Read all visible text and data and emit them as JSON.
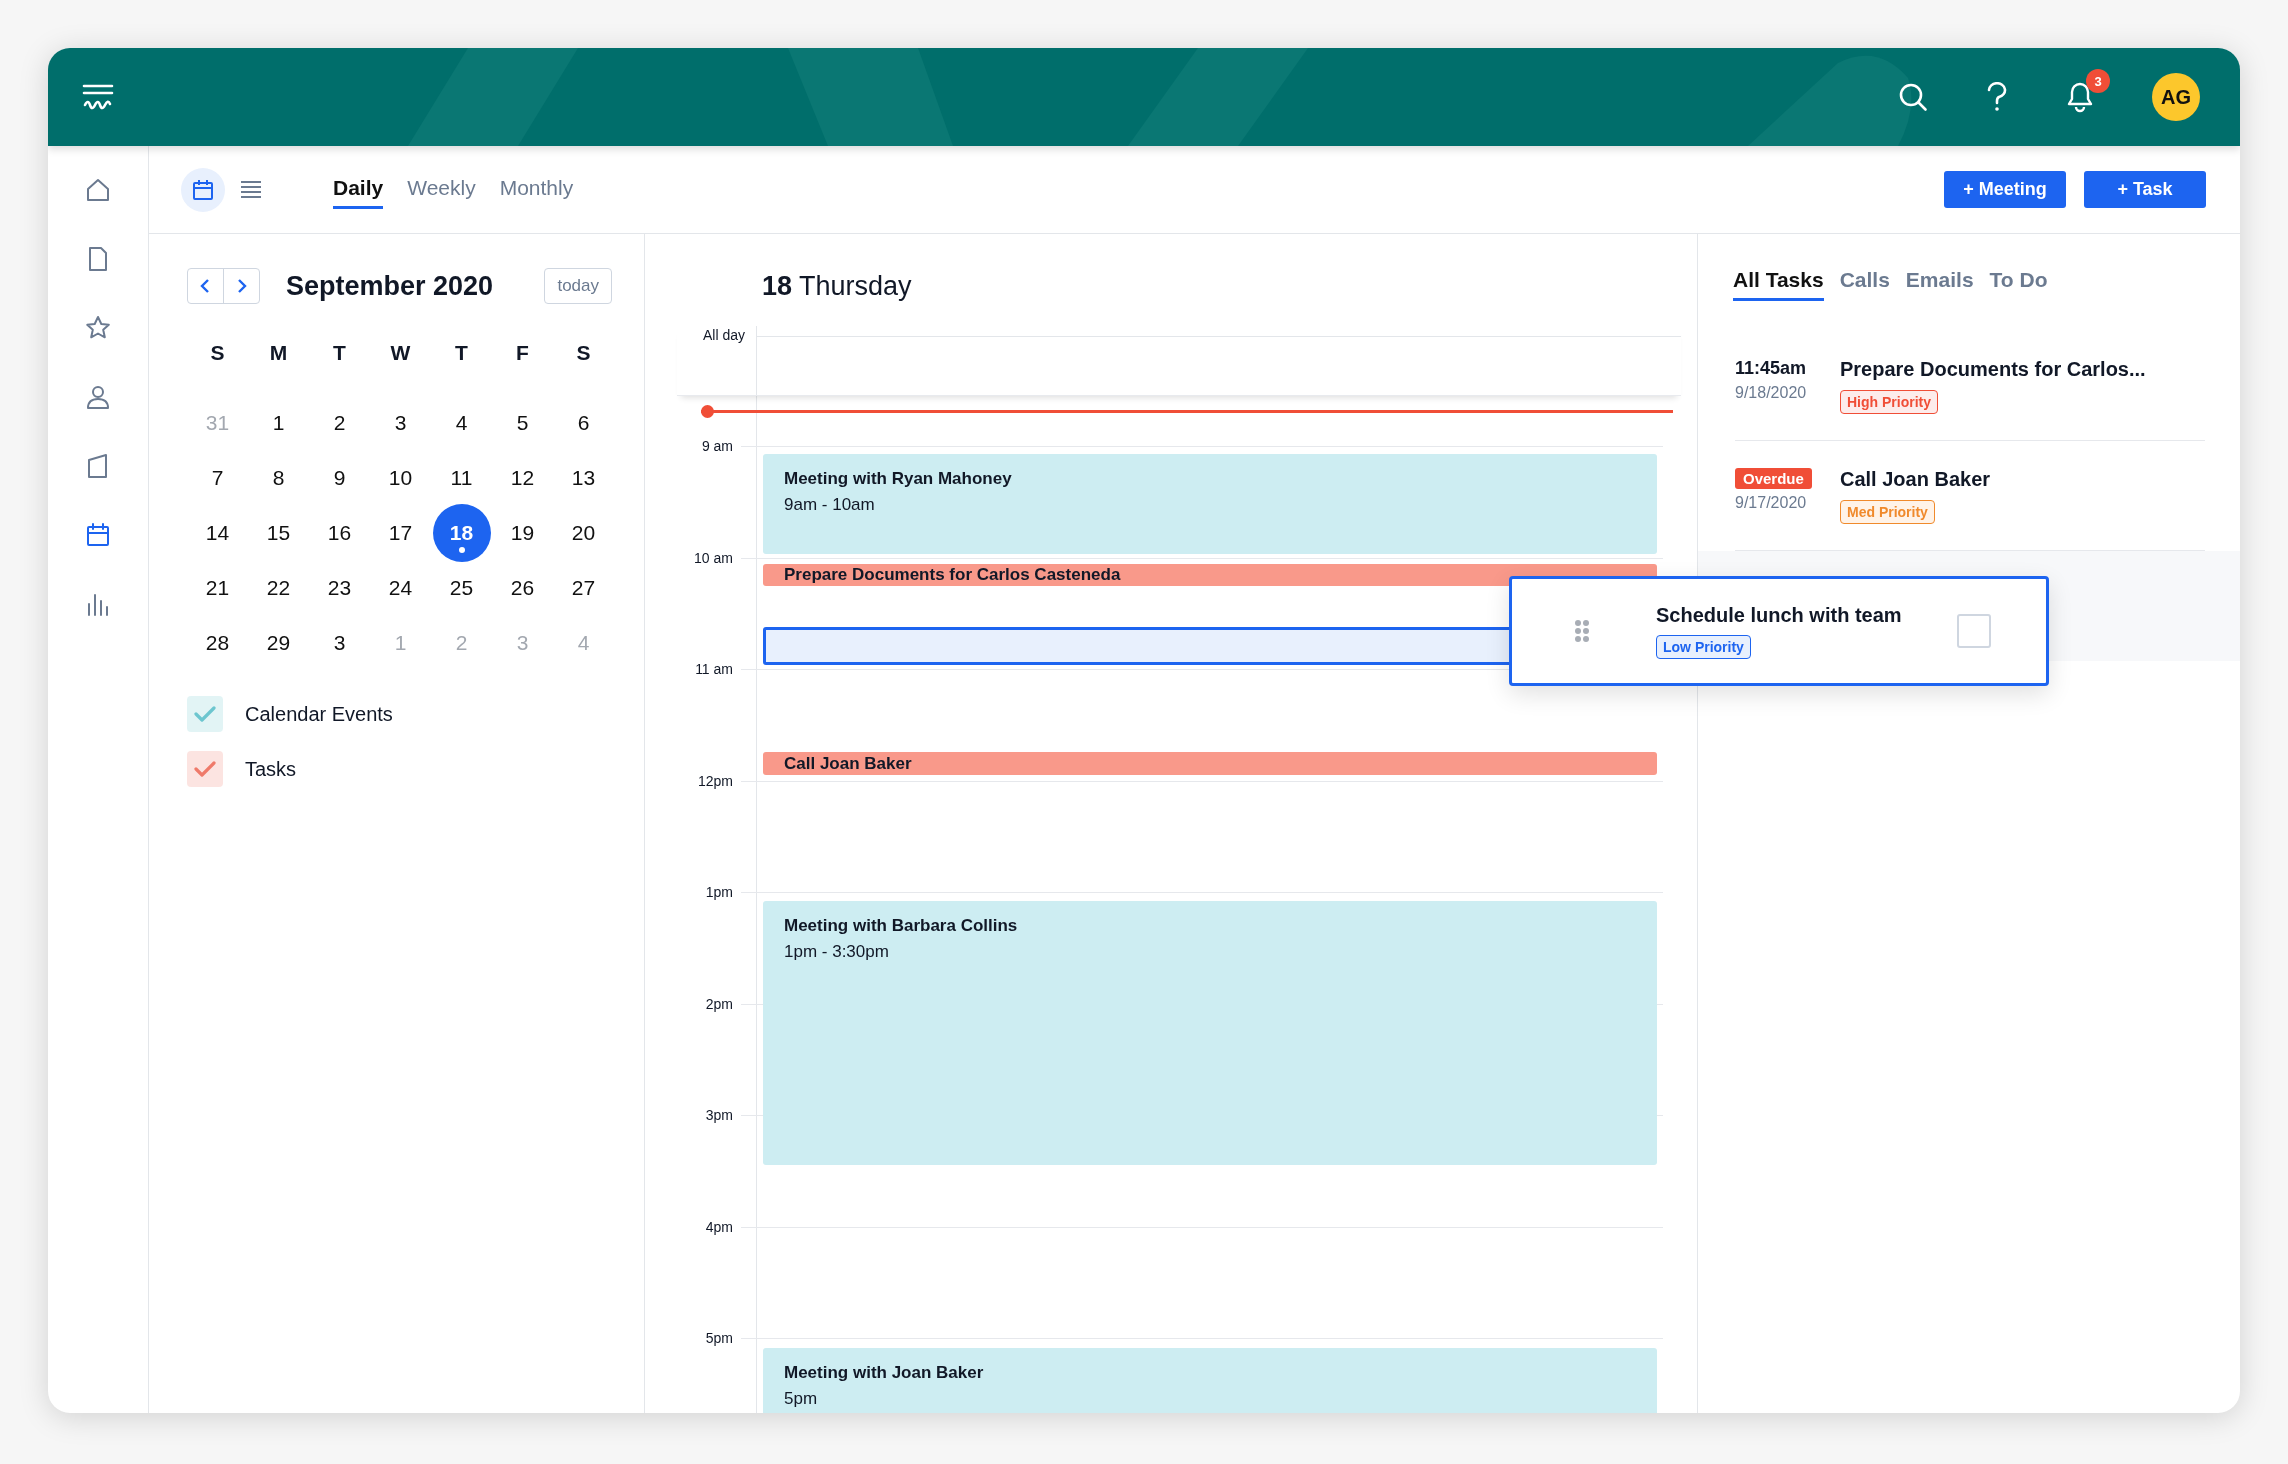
{
  "header": {
    "notification_count": "3",
    "avatar_initials": "AG"
  },
  "sidebar": {
    "items": [
      {
        "selected": false
      },
      {
        "selected": false
      },
      {
        "selected": false
      },
      {
        "selected": false
      },
      {
        "selected": false
      },
      {
        "selected": true
      },
      {
        "selected": false
      }
    ]
  },
  "toolbar": {
    "view_toggles": [
      {
        "selected": true
      },
      {
        "selected": false
      }
    ],
    "tabs": [
      {
        "label": "Daily",
        "selected": true
      },
      {
        "label": "Weekly",
        "selected": false
      },
      {
        "label": "Monthly",
        "selected": false
      }
    ],
    "buttons": [
      "+ Meeting",
      "+ Task"
    ]
  },
  "mini_calendar": {
    "title": "September 2020",
    "today_button": "today",
    "weekdays": [
      "S",
      "M",
      "T",
      "W",
      "T",
      "F",
      "S"
    ],
    "days": [
      {
        "label": "31",
        "outside": true,
        "selected": false
      },
      {
        "label": "1",
        "outside": false,
        "selected": false
      },
      {
        "label": "2",
        "outside": false,
        "selected": false
      },
      {
        "label": "3",
        "outside": false,
        "selected": false
      },
      {
        "label": "4",
        "outside": false,
        "selected": false
      },
      {
        "label": "5",
        "outside": false,
        "selected": false
      },
      {
        "label": "6",
        "outside": false,
        "selected": false
      },
      {
        "label": "7",
        "outside": false,
        "selected": false
      },
      {
        "label": "8",
        "outside": false,
        "selected": false
      },
      {
        "label": "9",
        "outside": false,
        "selected": false
      },
      {
        "label": "10",
        "outside": false,
        "selected": false
      },
      {
        "label": "11",
        "outside": false,
        "selected": false
      },
      {
        "label": "12",
        "outside": false,
        "selected": false
      },
      {
        "label": "13",
        "outside": false,
        "selected": false
      },
      {
        "label": "14",
        "outside": false,
        "selected": false
      },
      {
        "label": "15",
        "outside": false,
        "selected": false
      },
      {
        "label": "16",
        "outside": false,
        "selected": false
      },
      {
        "label": "17",
        "outside": false,
        "selected": false
      },
      {
        "label": "18",
        "outside": false,
        "selected": true
      },
      {
        "label": "19",
        "outside": false,
        "selected": false
      },
      {
        "label": "20",
        "outside": false,
        "selected": false
      },
      {
        "label": "21",
        "outside": false,
        "selected": false
      },
      {
        "label": "22",
        "outside": false,
        "selected": false
      },
      {
        "label": "23",
        "outside": false,
        "selected": false
      },
      {
        "label": "24",
        "outside": false,
        "selected": false
      },
      {
        "label": "25",
        "outside": false,
        "selected": false
      },
      {
        "label": "26",
        "outside": false,
        "selected": false
      },
      {
        "label": "27",
        "outside": false,
        "selected": false
      },
      {
        "label": "28",
        "outside": false,
        "selected": false
      },
      {
        "label": "29",
        "outside": false,
        "selected": false
      },
      {
        "label": "3",
        "outside": false,
        "selected": false
      },
      {
        "label": "1",
        "outside": true,
        "selected": false
      },
      {
        "label": "2",
        "outside": true,
        "selected": false
      },
      {
        "label": "3",
        "outside": true,
        "selected": false
      },
      {
        "label": "4",
        "outside": true,
        "selected": false
      }
    ]
  },
  "filters": [
    {
      "label": "Calendar Events",
      "checked": true,
      "color": "#6cc6cf"
    },
    {
      "label": "Tasks",
      "checked": true,
      "color": "#ef7a6a"
    }
  ],
  "day_view": {
    "day_number": "18",
    "day_name": "Thursday",
    "all_day_label": "All day",
    "hours": [
      "9 am",
      "10 am",
      "11 am",
      "12pm",
      "1pm",
      "2pm",
      "3pm",
      "4pm",
      "5pm"
    ],
    "events": [
      {
        "kind": "meeting",
        "title": "Meeting with Ryan Mahoney",
        "time": "9am - 10am"
      },
      {
        "kind": "task",
        "title": "Prepare Documents for Carlos Casteneda"
      },
      {
        "kind": "drop_target"
      },
      {
        "kind": "task",
        "title": "Call Joan Baker"
      },
      {
        "kind": "meeting",
        "title": "Meeting with Barbara Collins",
        "time": "1pm - 3:30pm"
      },
      {
        "kind": "meeting",
        "title": "Meeting with Joan Baker",
        "time": "5pm"
      }
    ]
  },
  "tasks_panel": {
    "tabs": [
      {
        "label": "All Tasks",
        "selected": true
      },
      {
        "label": "Calls",
        "selected": false
      },
      {
        "label": "Emails",
        "selected": false
      },
      {
        "label": "To Do",
        "selected": false
      }
    ],
    "items": [
      {
        "kind": "scheduled",
        "when": "11:45am",
        "date": "9/18/2020",
        "title": "Prepare Documents for Carlos...",
        "priority": {
          "kind": "high",
          "label": "High Priority"
        }
      },
      {
        "kind": "overdue",
        "when": "Overdue",
        "date": "9/17/2020",
        "title": "Call Joan Baker",
        "priority": {
          "kind": "med",
          "label": "Med Priority"
        }
      }
    ]
  },
  "dragged_task": {
    "title": "Schedule lunch with team",
    "priority": {
      "kind": "low",
      "label": "Low Priority"
    },
    "checked": false
  }
}
